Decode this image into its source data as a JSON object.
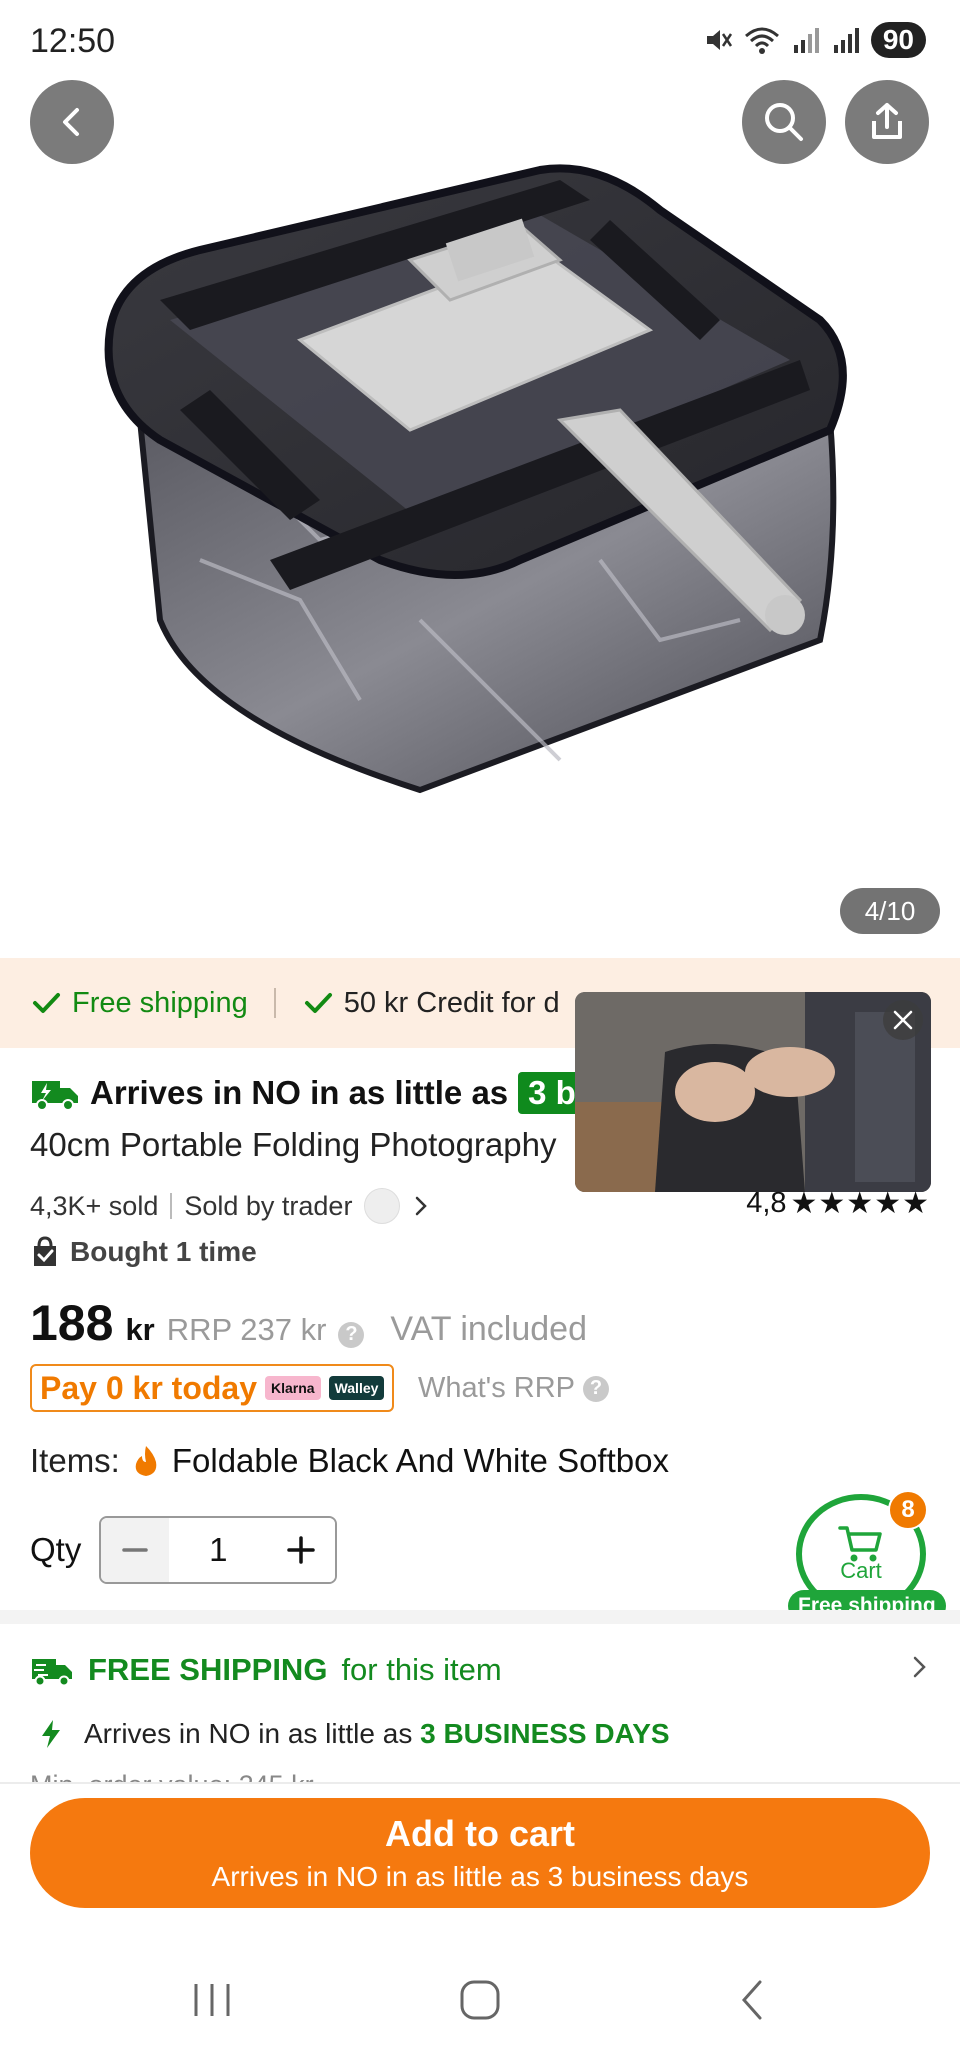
{
  "status_bar": {
    "time": "12:50",
    "battery": "90"
  },
  "hero": {
    "image_counter": "4/10",
    "image_alt": "product photo"
  },
  "promo": {
    "free_shipping": "Free shipping",
    "credit": "50 kr Credit for d"
  },
  "video": {
    "close_icon": "close-icon"
  },
  "product": {
    "arrives_prefix": "Arrives in NO in as little as",
    "arrives_days": "3 b",
    "title": "40cm Portable Folding Photography",
    "sold": "4,3K+ sold",
    "sold_by": "Sold by trader",
    "rating_value": "4,8",
    "rating_stars": "★★★★★",
    "bought": "Bought 1 time"
  },
  "price": {
    "amount": "188",
    "currency": "kr",
    "rrp": "RRP 237 kr",
    "vat": "VAT included",
    "pay_today": "Pay 0 kr today",
    "klarna": "Klarna",
    "walley": "Walley",
    "whats_rrp": "What's RRP"
  },
  "items": {
    "label": "Items:",
    "value": "Foldable Black And White Softbox"
  },
  "qty": {
    "label": "Qty",
    "value": "1",
    "minus": "−",
    "plus": "+"
  },
  "cart": {
    "label": "Cart",
    "badge": "8",
    "free_shipping": "Free shipping"
  },
  "shipping": {
    "title_bold": "FREE SHIPPING",
    "title_rest": "for this item",
    "arrives_text": "Arrives in NO in as little as",
    "arrives_days": "3 BUSINESS DAYS",
    "min_order": "Min. order value: 245 kr"
  },
  "cta": {
    "label": "Add to cart",
    "sub": "Arrives in NO in as little as 3 business days"
  },
  "colors": {
    "accent_orange": "#f5790f",
    "green": "#138a1f",
    "promo_bg": "#fdeee2"
  }
}
